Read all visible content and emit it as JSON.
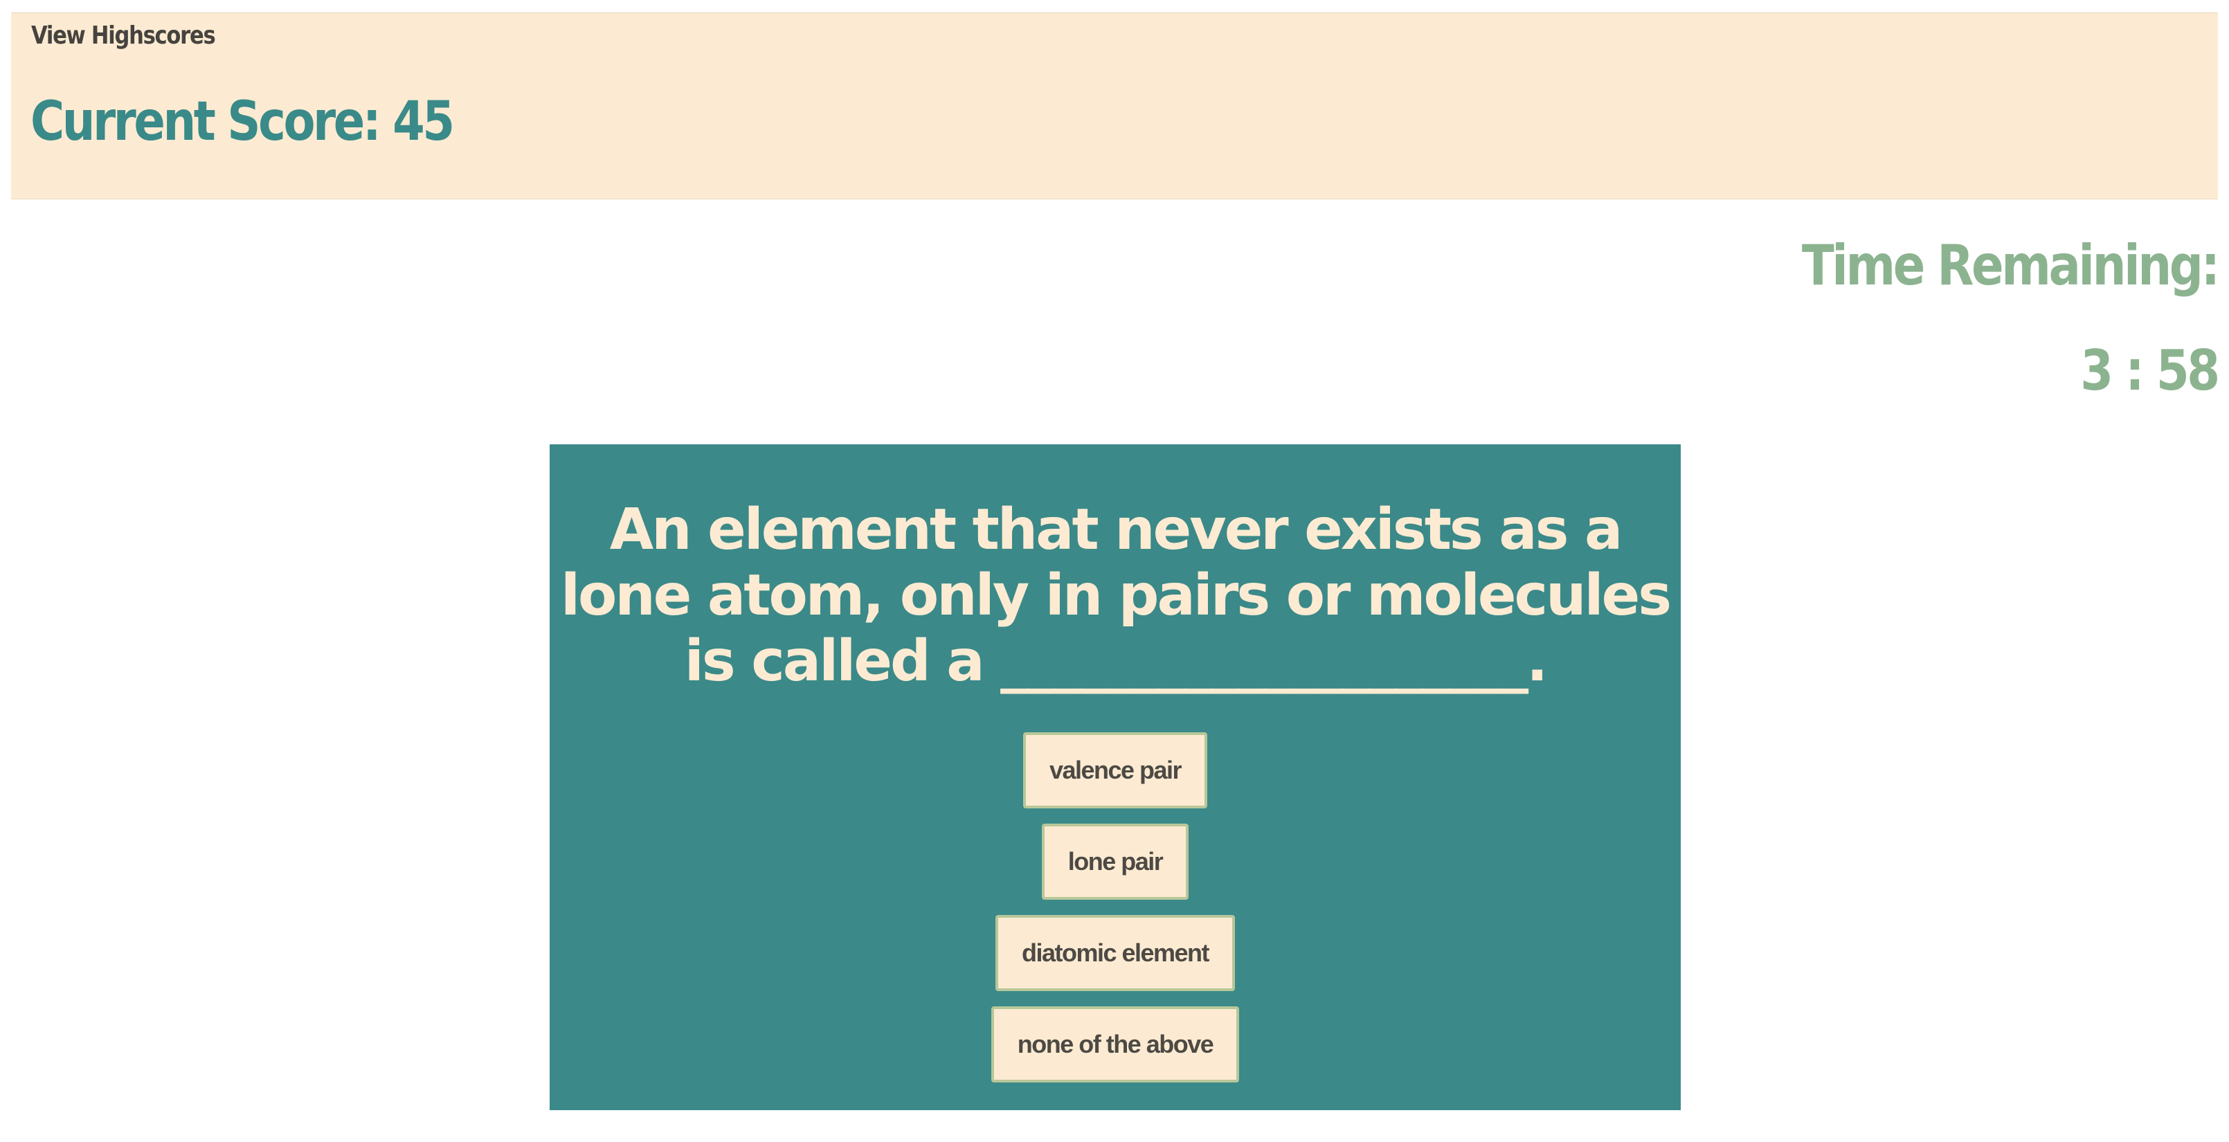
{
  "header": {
    "view_highscores": "View Highscores",
    "current_score": "Current Score: 45"
  },
  "timer": {
    "label": "Time Remaining:",
    "value": "3 : 58"
  },
  "quiz": {
    "question": "An element that never exists as a lone atom, only in pairs or molecules is called a ____________________.",
    "answers": [
      {
        "label": "valence pair"
      },
      {
        "label": "lone pair"
      },
      {
        "label": "diatomic element"
      },
      {
        "label": "none of the above"
      }
    ]
  },
  "colors": {
    "header_background": "#fcebd2",
    "score_teal": "#3a8a89",
    "timer_green": "#8cb38f",
    "card_teal": "#3b8989",
    "button_background": "#fcebd2",
    "button_border": "#b8c79a",
    "text_dark": "#46433f"
  }
}
